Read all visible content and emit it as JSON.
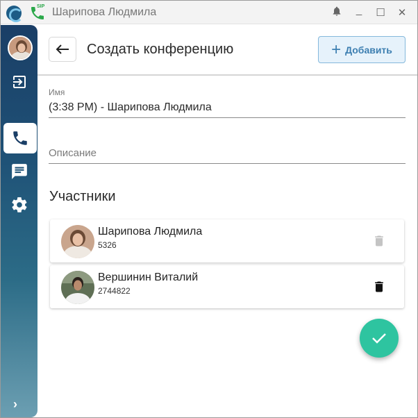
{
  "window": {
    "title": "Шарипова Людмила",
    "sip_label": "SIP",
    "buttons": {
      "minimize": "_",
      "maximize": "☐",
      "close": "✕"
    }
  },
  "sidebar": {
    "items": [
      {
        "name": "logout",
        "icon": "logout-icon"
      },
      {
        "name": "calls",
        "icon": "phone-icon",
        "active": true
      },
      {
        "name": "chat",
        "icon": "chat-icon"
      },
      {
        "name": "settings",
        "icon": "gear-icon"
      }
    ],
    "expand_label": "›"
  },
  "header": {
    "title": "Создать конференцию",
    "back_label": "←",
    "add_label": "Добавить"
  },
  "form": {
    "name_label": "Имя",
    "name_value": "(3:38 PM) - Шарипова Людмила",
    "description_placeholder": "Описание"
  },
  "participants": {
    "title": "Участники",
    "items": [
      {
        "name": "Шарипова Людмила",
        "number": "5326",
        "delete_enabled": false
      },
      {
        "name": "Вершинин Виталий",
        "number": "2744822",
        "delete_enabled": true
      }
    ]
  },
  "colors": {
    "accent": "#3d7fb1",
    "fab": "#2ec4a0",
    "sidebar_top": "#1a3e66",
    "sidebar_bottom": "#6c9fb2"
  }
}
